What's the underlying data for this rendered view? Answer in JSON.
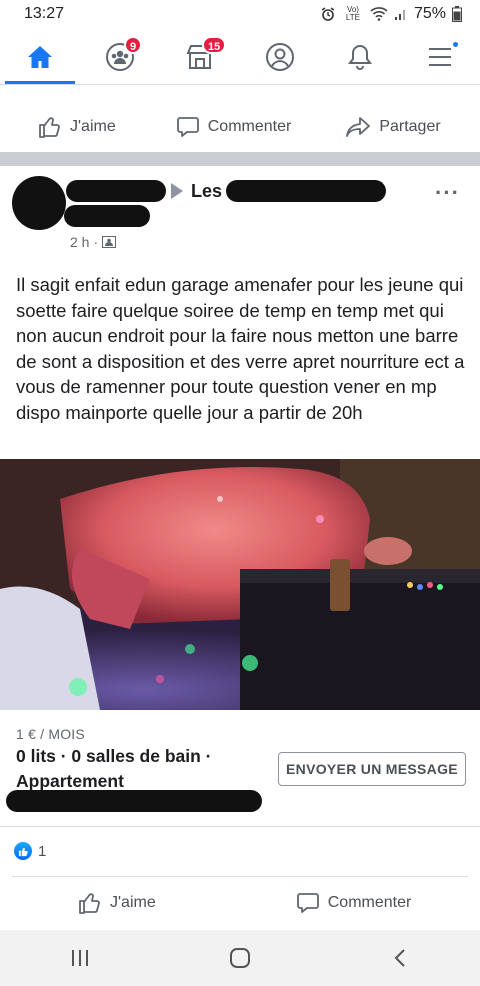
{
  "status_bar": {
    "time": "13:27",
    "network": "Vo) LTE",
    "battery": "75%",
    "icons": [
      "alarm-icon",
      "wifi-icon",
      "signal-icon",
      "battery-icon"
    ]
  },
  "top_nav": {
    "accent_color": "#1877f2",
    "tabs": [
      {
        "icon": "home-icon",
        "active": true
      },
      {
        "icon": "groups-icon",
        "badge": "9"
      },
      {
        "icon": "marketplace-icon",
        "badge": "15"
      },
      {
        "icon": "profile-icon"
      },
      {
        "icon": "bell-icon"
      },
      {
        "icon": "menu-icon",
        "dot": true
      }
    ]
  },
  "prev_post_actions": {
    "like": "J'aime",
    "comment": "Commenter",
    "share": "Partager"
  },
  "post": {
    "group_prefix": "Les",
    "time": "2 h",
    "audience_icon": "group-audience-icon",
    "text": "Il sagit enfait edun garage amenafer pour les jeune qui soette faire quelque soiree de temp en temp met qui non aucun endroit pour la faire nous metton une barre de sont a disposition et des verre apret nourriture ect a vous de ramenner pour toute question vener en mp dispo mainporte quelle jour a partir de 20h",
    "listing": {
      "price": "1 € / MOIS",
      "details": "0 lits · 0 salles de bain · Appartement",
      "message_button": "ENVOYER UN MESSAGE"
    },
    "reactions_count": "1",
    "actions": {
      "like": "J'aime",
      "comment": "Commenter"
    }
  },
  "system_nav": {
    "icons": [
      "recent-apps-icon",
      "home-circle-icon",
      "back-icon"
    ]
  }
}
